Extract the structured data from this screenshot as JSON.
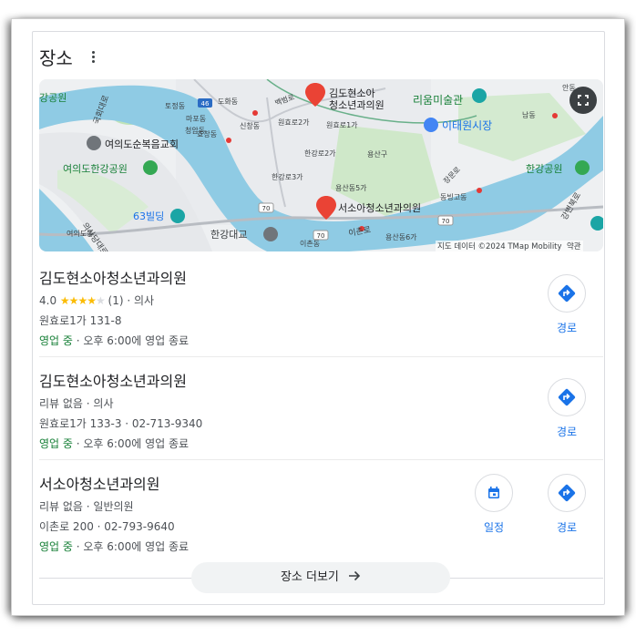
{
  "header": {
    "title": "장소"
  },
  "map": {
    "attribution": "지도 데이터 ©2024 TMap Mobility",
    "terms": "약관",
    "labels": [
      "강공원",
      "국회대로",
      "도화동",
      "토정동",
      "마포동",
      "효창동",
      "백범로",
      "신창동",
      "원효로2가",
      "원효로1가",
      "청암동",
      "한강로2가",
      "한강로3가",
      "용산구",
      "용산동5가",
      "김도현소아",
      "청소년과의원",
      "리움미술관",
      "이태원시장",
      "남동",
      "여의도순복음교회",
      "여의도한강공원",
      "한강공원",
      "장문로",
      "동빙고동",
      "63빌딩",
      "서소아청소년과의원",
      "이촌로",
      "용산동6가",
      "한강대교",
      "이촌동",
      "의사당대로",
      "여의도동",
      "강변북로",
      "안동"
    ],
    "route_numbers": [
      "46",
      "70",
      "70",
      "70"
    ]
  },
  "places": [
    {
      "name": "김도현소아청소년과의원",
      "rating": "4.0",
      "stars_full": "★★★★",
      "stars_empty": "★",
      "reviews": "(1)",
      "category": "· 의사",
      "address": "원효로1가 131-8",
      "status": "영업 중",
      "hours": "· 오후 6:00에 영업 종료",
      "route_label": "경로"
    },
    {
      "name": "김도현소아청소년과의원",
      "meta": "리뷰 없음 · 의사",
      "address": "원효로1가 133-3 · 02-713-9340",
      "status": "영업 중",
      "hours": "· 오후 6:00에 영업 종료",
      "route_label": "경로"
    },
    {
      "name": "서소아청소년과의원",
      "meta": "리뷰 없음 · 일반의원",
      "address": "이촌로 200 · 02-793-9640",
      "status": "영업 중",
      "hours": "· 오후 6:00에 영업 종료",
      "schedule_label": "일정",
      "route_label": "경로"
    }
  ],
  "footer": {
    "more_label": "장소 더보기"
  },
  "colors": {
    "accent": "#1a73e8",
    "open": "#188038",
    "star": "#fbbc04",
    "water": "#8ccbe6",
    "park": "#c5e6c1"
  },
  "icons": [
    "more-vert-icon",
    "expand-icon",
    "directions-icon",
    "calendar-icon",
    "arrow-right-icon",
    "place-pin-icon"
  ]
}
